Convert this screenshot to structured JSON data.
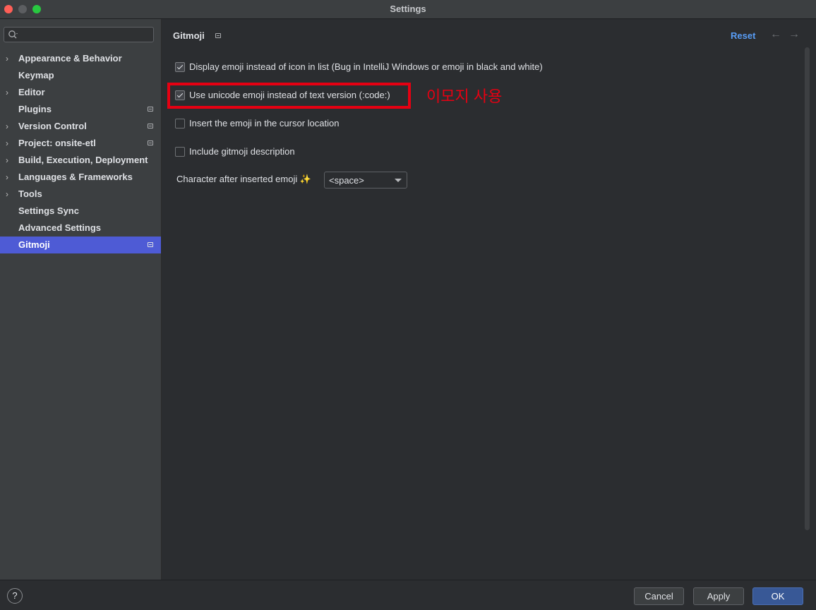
{
  "window": {
    "title": "Settings"
  },
  "search": {
    "placeholder": "",
    "value": ""
  },
  "sidebar": {
    "items": [
      {
        "label": "Appearance & Behavior",
        "expandable": true,
        "badge": false,
        "selected": false
      },
      {
        "label": "Keymap",
        "expandable": false,
        "badge": false,
        "selected": false
      },
      {
        "label": "Editor",
        "expandable": true,
        "badge": false,
        "selected": false
      },
      {
        "label": "Plugins",
        "expandable": false,
        "badge": true,
        "selected": false
      },
      {
        "label": "Version Control",
        "expandable": true,
        "badge": true,
        "selected": false
      },
      {
        "label": "Project: onsite-etl",
        "expandable": true,
        "badge": true,
        "selected": false
      },
      {
        "label": "Build, Execution, Deployment",
        "expandable": true,
        "badge": false,
        "selected": false
      },
      {
        "label": "Languages & Frameworks",
        "expandable": true,
        "badge": false,
        "selected": false
      },
      {
        "label": "Tools",
        "expandable": true,
        "badge": false,
        "selected": false
      },
      {
        "label": "Settings Sync",
        "expandable": false,
        "badge": false,
        "selected": false
      },
      {
        "label": "Advanced Settings",
        "expandable": false,
        "badge": false,
        "selected": false
      },
      {
        "label": "Gitmoji",
        "expandable": false,
        "badge": true,
        "selected": true
      }
    ]
  },
  "page": {
    "title": "Gitmoji",
    "reset_label": "Reset",
    "options": [
      {
        "label": "Display emoji instead of icon in list (Bug in IntelliJ Windows or emoji in black and white)",
        "checked": true
      },
      {
        "label": "Use unicode emoji instead of text version (:code:)",
        "checked": true
      },
      {
        "label": "Insert the emoji in the cursor location",
        "checked": false
      },
      {
        "label": "Include gitmoji description",
        "checked": false
      }
    ],
    "char_after_label": "Character after inserted emoji",
    "char_after_emoji": "✨",
    "char_after_value": "<space>"
  },
  "annotation": {
    "text": "이모지 사용",
    "color": "#e60012"
  },
  "footer": {
    "help_label": "?",
    "cancel_label": "Cancel",
    "apply_label": "Apply",
    "ok_label": "OK"
  },
  "colors": {
    "accent": "#4e5bd5",
    "link": "#589df6",
    "ok_button": "#385896",
    "highlight": "#e60012"
  }
}
